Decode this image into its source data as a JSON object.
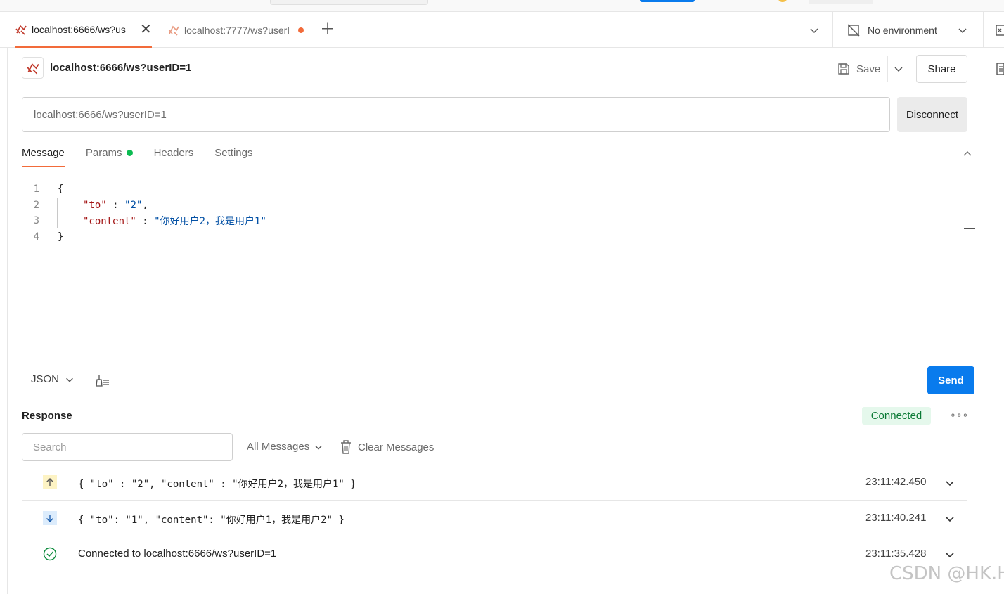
{
  "tabs": [
    {
      "label": "localhost:6666/ws?us",
      "active": true
    },
    {
      "label": "localhost:7777/ws?userI",
      "active": false,
      "unsaved": true
    }
  ],
  "environment": {
    "label": "No environment"
  },
  "request": {
    "title": "localhost:6666/ws?userID=1",
    "url": "localhost:6666/ws?userID=1",
    "save_label": "Save",
    "share_label": "Share",
    "disconnect_label": "Disconnect"
  },
  "subtabs": [
    {
      "label": "Message",
      "active": true
    },
    {
      "label": "Params",
      "indicator": true
    },
    {
      "label": "Headers"
    },
    {
      "label": "Settings"
    }
  ],
  "editor": {
    "line_numbers": [
      "1",
      "2",
      "3",
      "4"
    ],
    "lines": {
      "l1": "{",
      "l2_key": "\"to\"",
      "l2_sep": " : ",
      "l2_val": "\"2\"",
      "l2_end": ",",
      "l3_key": "\"content\"",
      "l3_sep": " : ",
      "l3_val": "\"你好用户2，我是用户1\"",
      "l4": "}"
    }
  },
  "toolbar": {
    "format": "JSON",
    "send_label": "Send"
  },
  "response": {
    "title": "Response",
    "status": "Connected",
    "more": "∘∘∘",
    "search_placeholder": "Search",
    "filter": "All Messages",
    "clear_label": "Clear Messages",
    "messages": [
      {
        "direction": "sent",
        "text": "{ \"to\" : \"2\", \"content\" : \"你好用户2，我是用户1\" }",
        "time": "23:11:42.450"
      },
      {
        "direction": "received",
        "text": "{ \"to\": \"1\", \"content\": \"你好用户1，我是用户2\" }",
        "time": "23:11:40.241"
      },
      {
        "direction": "connected",
        "text": "Connected to localhost:6666/ws?userID=1",
        "time": "23:11:35.428"
      }
    ]
  },
  "watermark": "CSDN @HK.H",
  "colors": {
    "accent": "#f26b3a",
    "primary": "#097bed",
    "success": "#0cbb52"
  }
}
